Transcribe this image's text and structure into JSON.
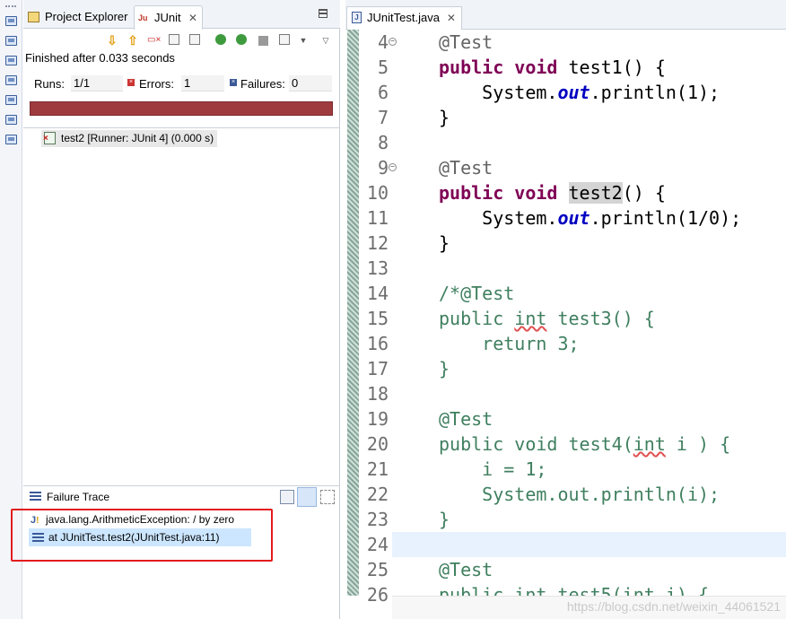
{
  "trim_icons": [
    "view-icon",
    "view-icon",
    "view-icon",
    "view-icon",
    "view-icon",
    "view-icon",
    "view-icon"
  ],
  "view_tabs": {
    "project_explorer": "Project Explorer",
    "junit": "JUnit",
    "junit_icon_text": "Ju"
  },
  "toolbar": {
    "icons": [
      "next-failure-icon",
      "previous-failure-icon",
      "show-failures-only-icon",
      "scroll-lock-icon",
      "layout-icon",
      "rerun-icon",
      "rerun-failed-first-icon",
      "stop-icon",
      "history-icon",
      "view-menu-icon"
    ]
  },
  "status": "Finished after 0.033 seconds",
  "counters": {
    "runs_label": "Runs:",
    "runs_value": "1/1",
    "errors_label": "Errors:",
    "errors_value": "1",
    "failures_label": "Failures:",
    "failures_value": "0"
  },
  "progress": {
    "fraction": 1.0,
    "color": "#9e3b3f"
  },
  "test_tree": {
    "row": "test2 [Runner: JUnit 4] (0.000 s)"
  },
  "failure_trace": {
    "title": "Failure Trace",
    "exception": "java.lang.ArithmeticException: / by zero",
    "frame": "at JUnitTest.test2(JUnitTest.java:11)"
  },
  "editor": {
    "tab_label": "JUnitTest.java",
    "line_numbers": [
      "4",
      "5",
      "6",
      "7",
      "8",
      "9",
      "10",
      "11",
      "12",
      "13",
      "14",
      "15",
      "16",
      "17",
      "18",
      "19",
      "20",
      "21",
      "22",
      "23",
      "24",
      "25",
      "26"
    ],
    "current_line": "24"
  },
  "watermark": "https://blog.csdn.net/weixin_44061521",
  "colors": {
    "keyword": "#7f0055",
    "static_field": "#0000c0",
    "comment": "#3f7f5f",
    "error_bar": "#9e3b3f",
    "highlight_box": "#e31c1c"
  }
}
